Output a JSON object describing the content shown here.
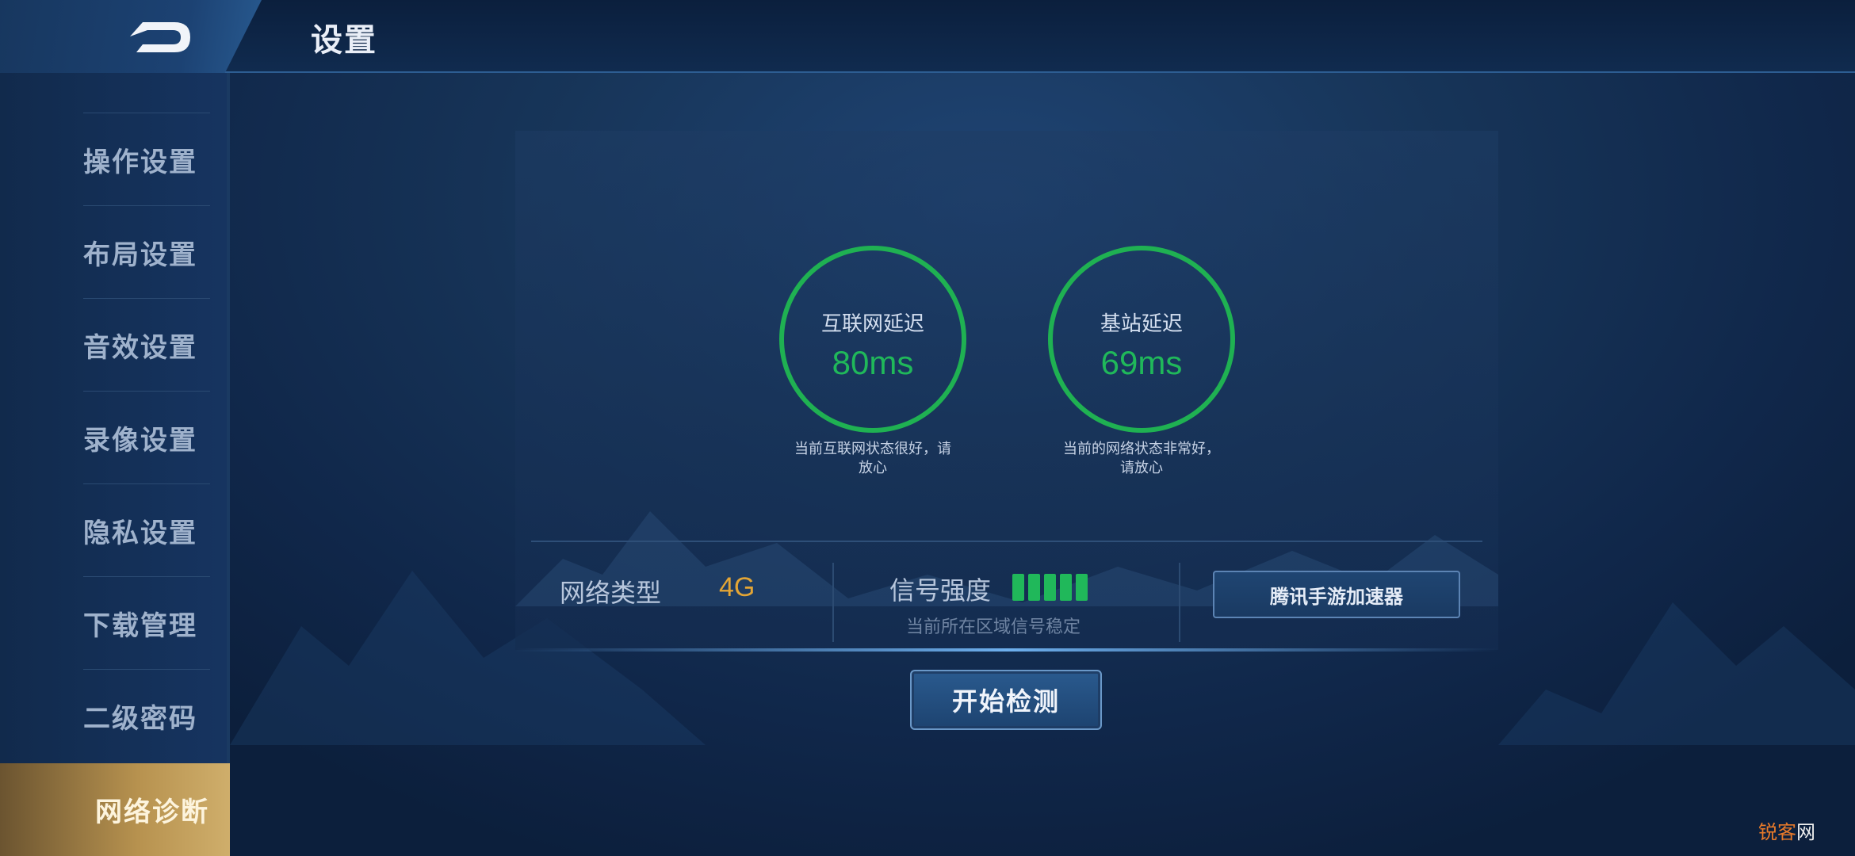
{
  "header": {
    "title": "设置"
  },
  "sidebar": {
    "items": [
      {
        "label": "操作设置"
      },
      {
        "label": "布局设置"
      },
      {
        "label": "音效设置"
      },
      {
        "label": "录像设置"
      },
      {
        "label": "隐私设置"
      },
      {
        "label": "下载管理"
      },
      {
        "label": "二级密码"
      },
      {
        "label": "网络诊断",
        "active": true
      }
    ]
  },
  "diagnosis": {
    "internet": {
      "label": "互联网延迟",
      "value": "80ms",
      "note_line1": "当前互联网状态很好，请",
      "note_line2": "放心"
    },
    "base_station": {
      "label": "基站延迟",
      "value": "69ms",
      "note_line1": "当前的网络状态非常好，",
      "note_line2": "请放心"
    },
    "network_type": {
      "label": "网络类型",
      "value": "4G"
    },
    "signal": {
      "label": "信号强度",
      "bars": 5,
      "max_bars": 5,
      "note": "当前所在区域信号稳定"
    },
    "accelerator_button": "腾讯手游加速器",
    "start_button": "开始检测"
  },
  "watermark": {
    "part1": "锐客",
    "part2": "网"
  },
  "colors": {
    "good": "#20b85a",
    "value_gold": "#e3a535",
    "active_tab": "#b7924f"
  },
  "icons": {
    "back": "back-arrow-icon"
  }
}
